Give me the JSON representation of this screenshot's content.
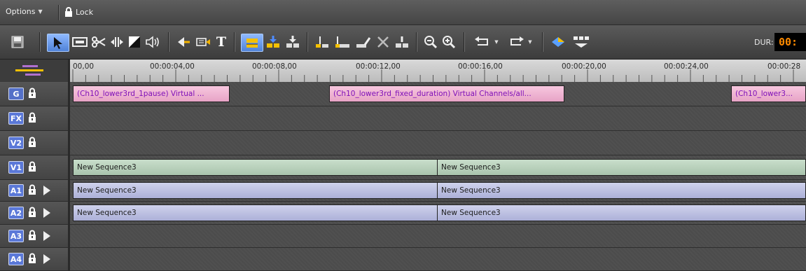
{
  "menubar": {
    "options_label": "Options",
    "lock_label": "Lock"
  },
  "toolbar": {
    "icons": [
      "save-icon",
      "select-arrow-icon",
      "trim-icon",
      "razor-icon",
      "slip-icon",
      "fade-icon",
      "audio-icon",
      "lift-icon",
      "overwrite-icon",
      "title-icon",
      "layer-icon",
      "insert-icon",
      "extract-icon",
      "split-icon",
      "ripple-icon",
      "link-icon",
      "delete-icon",
      "match-icon",
      "zoom-out-icon",
      "zoom-in-icon",
      "undo-icon",
      "redo-icon",
      "render-icon",
      "multicam-icon"
    ],
    "title_glyph": "T",
    "duration_label": "DUR:",
    "duration_value": "00:"
  },
  "ruler": {
    "timecodes": [
      "00,00",
      "00:00:04,00",
      "00:00:08,00",
      "00:00:12,00",
      "00:00:16,00",
      "00:00:20,00",
      "00:00:24,00",
      "00:00:28"
    ]
  },
  "tracks": [
    {
      "id": "G",
      "badge": "G",
      "badge_color": "#5470c8",
      "has_arrow": false,
      "clips": [
        {
          "label": "(Ch10_lower3rd_1pause) Virtual ...",
          "style": "pink"
        },
        {
          "label": "(Ch10_lower3rd_fixed_duration) Virtual Channels/all...",
          "style": "pink"
        },
        {
          "label": "(Ch10_lower3...",
          "style": "pink"
        }
      ]
    },
    {
      "id": "FX",
      "badge": "FX",
      "badge_color": "#5a78d8",
      "has_arrow": false,
      "clips": []
    },
    {
      "id": "V2",
      "badge": "V2",
      "badge_color": "#5a78d8",
      "has_arrow": false,
      "clips": []
    },
    {
      "id": "V1",
      "badge": "V1",
      "badge_color": "#5a78d8",
      "has_arrow": false,
      "clips": [
        {
          "label": "New Sequence3",
          "style": "green"
        },
        {
          "label": "New Sequence3",
          "style": "green"
        }
      ]
    },
    {
      "id": "A1",
      "badge": "A1",
      "badge_color": "#5a78d8",
      "has_arrow": true,
      "clips": [
        {
          "label": "New Sequence3",
          "style": "blue"
        },
        {
          "label": "New Sequence3",
          "style": "blue"
        }
      ]
    },
    {
      "id": "A2",
      "badge": "A2",
      "badge_color": "#5a78d8",
      "has_arrow": true,
      "clips": [
        {
          "label": "New Sequence3",
          "style": "blue"
        },
        {
          "label": "New Sequence3",
          "style": "blue"
        }
      ]
    },
    {
      "id": "A3",
      "badge": "A3",
      "badge_color": "#5a78d8",
      "has_arrow": true,
      "clips": []
    },
    {
      "id": "A4",
      "badge": "A4",
      "badge_color": "#5a78d8",
      "has_arrow": true,
      "clips": []
    }
  ]
}
